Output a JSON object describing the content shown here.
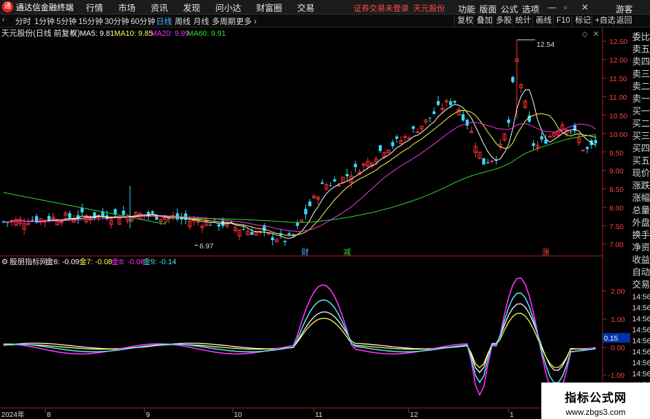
{
  "app": {
    "name": "通达信金融终端",
    "status": "证券交易未登录",
    "stock_short": "天元股份"
  },
  "menu": [
    "行情",
    "市场",
    "资讯",
    "发现",
    "问小达",
    "财富圈",
    "交易"
  ],
  "right_menu": [
    "功能",
    "版面",
    "公式",
    "选项"
  ],
  "guest": "游客",
  "periods": [
    "分时",
    "1分钟",
    "5分钟",
    "15分钟",
    "30分钟",
    "60分钟",
    "日线",
    "周线",
    "月线",
    "多周期",
    "更多"
  ],
  "selected_period": "日线",
  "toolbar": [
    "复权",
    "叠加",
    "多股",
    "统计",
    "画线",
    "F10",
    "标记",
    "+自选",
    "返回"
  ],
  "main_title": "天元股份(日线 前复权)",
  "ma_labels": [
    {
      "text": "MA5: 9.81",
      "color": "#ffffff"
    },
    {
      "text": "MA10: 9.85",
      "color": "#ffff55"
    },
    {
      "text": "MA20: 9.99",
      "color": "#ff33ff"
    },
    {
      "text": "MA60: 9.91",
      "color": "#33dd33"
    }
  ],
  "price_axis": [
    "12.50",
    "12.00",
    "11.50",
    "11.00",
    "10.50",
    "10.00",
    "9.50",
    "9.00",
    "8.50",
    "8.00",
    "7.50",
    "7.00"
  ],
  "high_marker": "12.54",
  "low_marker": "6.97",
  "events": [
    {
      "text": "财",
      "color": "#4fb4ff"
    },
    {
      "text": "减",
      "color": "#33dd33"
    },
    {
      "text": "涨",
      "color": "#ff4a4a"
    }
  ],
  "sub_title": "殷朋指标网",
  "sub_labels": [
    {
      "text": "金6: -0.09",
      "color": "#ffffff"
    },
    {
      "text": "金7: -0.08",
      "color": "#ffff55"
    },
    {
      "text": "金8: -0.06",
      "color": "#ff33ff"
    },
    {
      "text": "金9: -0.14",
      "color": "#55ddee"
    }
  ],
  "sub_axis": [
    "2.00",
    "1.00",
    "0.00",
    "-1.00"
  ],
  "sub_current": "0.15",
  "date_labels": [
    "2024年",
    "8",
    "9",
    "10",
    "11",
    "12",
    "1"
  ],
  "right_panel_top": [
    "委比",
    "卖五",
    "卖四",
    "卖三",
    "卖二",
    "卖一",
    "买一",
    "买二",
    "买三",
    "买四",
    "买五",
    "现价",
    "涨跌",
    "涨幅",
    "总量",
    "外盘",
    "换手",
    "净资",
    "收益"
  ],
  "right_panel_bottom": [
    "自动",
    "交易",
    "14:56",
    "14:56",
    "14:56",
    "14:56",
    "14:56",
    "14:56",
    "14:56",
    "14:56",
    "14:56"
  ],
  "watermark": {
    "title": "指标公式网",
    "url": "www.zbgs3.com"
  },
  "colors": {
    "up": "#ff3333",
    "down": "#33ddff",
    "grid": "#4a0000",
    "axis": "#aa2222"
  }
}
